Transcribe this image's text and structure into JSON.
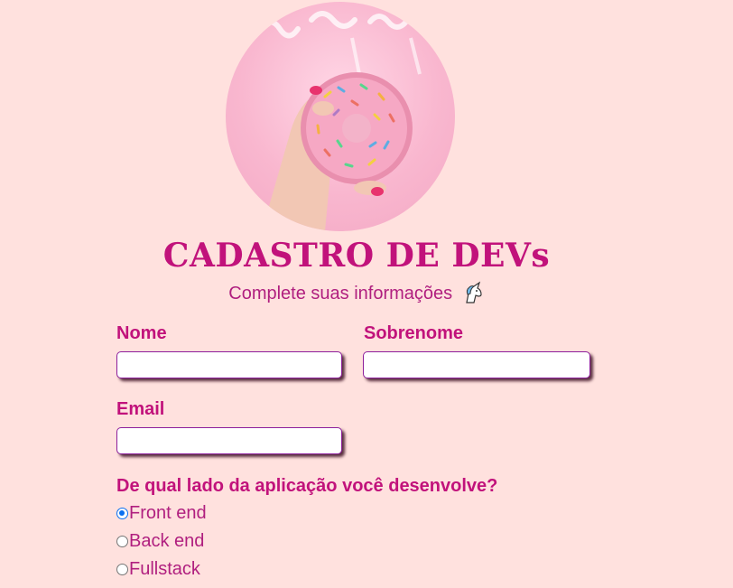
{
  "header": {
    "image_alt": "donut-photo",
    "title": "CADASTRO DE DEVs",
    "subtitle": "Complete suas informações",
    "subtitle_icon": "unicorn-icon"
  },
  "form": {
    "first_name_label": "Nome",
    "first_name_value": "",
    "last_name_label": "Sobrenome",
    "last_name_value": "",
    "email_label": "Email",
    "email_value": "",
    "question": "De qual lado da aplicação você desenvolve?",
    "options": [
      {
        "label": "Front end",
        "checked": true
      },
      {
        "label": "Back end",
        "checked": false
      },
      {
        "label": "Fullstack",
        "checked": false
      }
    ]
  },
  "colors": {
    "background": "#ffe1de",
    "accent": "#c1127b",
    "input_border": "#8e1f9c"
  }
}
